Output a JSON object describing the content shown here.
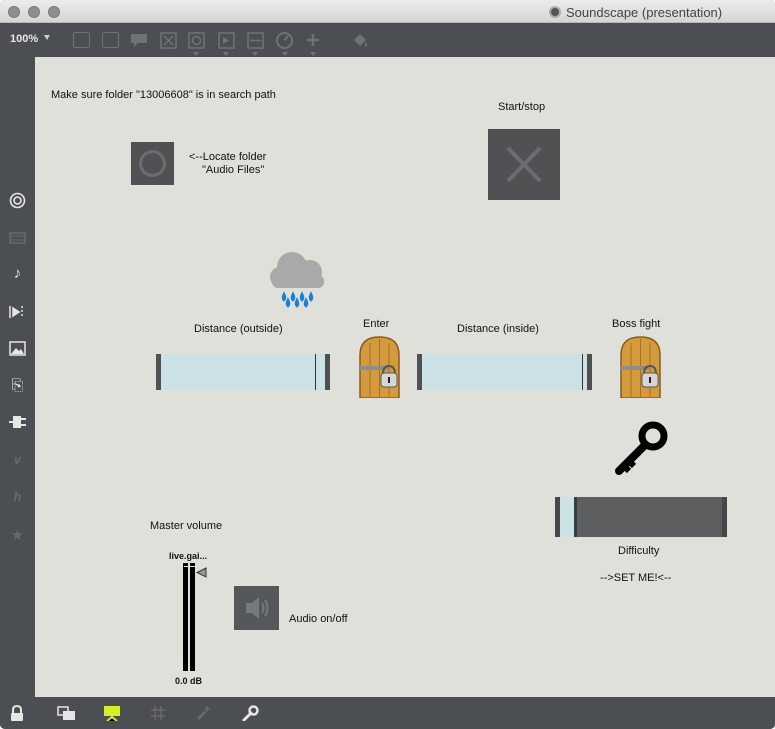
{
  "window": {
    "title": "Soundscape (presentation)"
  },
  "toolbar": {
    "zoom": "100%",
    "icons": [
      "presentation-frame-icon",
      "message-box-icon",
      "comment-icon",
      "toggle-x-icon",
      "button-icon",
      "playbar-icon",
      "slider-icon",
      "dial-icon",
      "add-icon",
      "paint-bucket-icon"
    ]
  },
  "sidebar": {
    "icons": [
      "target-icon",
      "film-strip-icon",
      "music-note-icon",
      "media-icon",
      "image-icon",
      "paperclip-icon",
      "plug-icon",
      "vimeo-icon",
      "hype-icon",
      "star-icon"
    ]
  },
  "canvas": {
    "instruction": "Make sure folder \"13006608\" is in search path",
    "locate_line1": "<--Locate folder",
    "locate_line2": "\"Audio Files\"",
    "start_stop": "Start/stop",
    "distance_outside": "Distance (outside)",
    "enter": "Enter",
    "distance_inside": "Distance (inside)",
    "boss_fight": "Boss fight",
    "difficulty": "Difficulty",
    "set_me": "-->SET ME!<--",
    "master_volume": "Master volume",
    "gain_name": "live.gai...",
    "gain_value": "0.0 dB",
    "audio_toggle": "Audio on/off"
  },
  "sliders": {
    "distance_outside": 0.95,
    "distance_inside": 0.98,
    "difficulty": 0.1
  },
  "colors": {
    "canvas_bg": "#e0e0da",
    "chrome_bg": "#4b4e52",
    "slider_fill": "#cde2e6",
    "rain_drop": "#1a7fd8",
    "cloud": "#a9a9a9",
    "door_wood": "#d39a3e",
    "presentation_active": "#d7ef2a"
  }
}
